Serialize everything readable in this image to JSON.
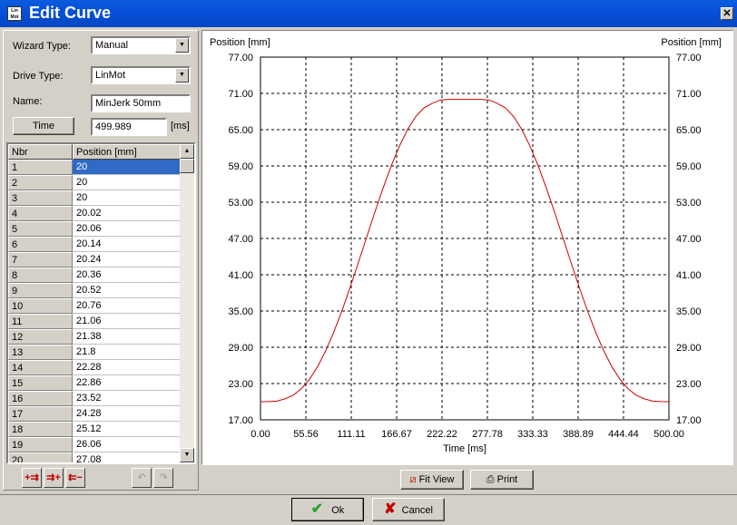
{
  "window": {
    "title": "Edit Curve",
    "app_icon_text": "Lin Mot",
    "close_glyph": "✕"
  },
  "form": {
    "wizard_type_label": "Wizard Type:",
    "wizard_type_value": "Manual",
    "drive_type_label": "Drive Type:",
    "drive_type_value": "LinMot",
    "name_label": "Name:",
    "name_value": "MinJerk 50mm",
    "time_button_label": "Time",
    "time_value": "499.989",
    "time_unit": "[ms]"
  },
  "table": {
    "headers": [
      "Nbr",
      "Position [mm]"
    ],
    "selected_row": 0,
    "rows": [
      {
        "nbr": "1",
        "pos": "20"
      },
      {
        "nbr": "2",
        "pos": "20"
      },
      {
        "nbr": "3",
        "pos": "20"
      },
      {
        "nbr": "4",
        "pos": "20.02"
      },
      {
        "nbr": "5",
        "pos": "20.06"
      },
      {
        "nbr": "6",
        "pos": "20.14"
      },
      {
        "nbr": "7",
        "pos": "20.24"
      },
      {
        "nbr": "8",
        "pos": "20.36"
      },
      {
        "nbr": "9",
        "pos": "20.52"
      },
      {
        "nbr": "10",
        "pos": "20.76"
      },
      {
        "nbr": "11",
        "pos": "21.06"
      },
      {
        "nbr": "12",
        "pos": "21.38"
      },
      {
        "nbr": "13",
        "pos": "21.8"
      },
      {
        "nbr": "14",
        "pos": "22.28"
      },
      {
        "nbr": "15",
        "pos": "22.86"
      },
      {
        "nbr": "16",
        "pos": "23.52"
      },
      {
        "nbr": "17",
        "pos": "24.28"
      },
      {
        "nbr": "18",
        "pos": "25.12"
      },
      {
        "nbr": "19",
        "pos": "26.06"
      },
      {
        "nbr": "20",
        "pos": "27.08"
      }
    ]
  },
  "toolbar": {
    "insert_before_glyph": "+⇉",
    "insert_after_glyph": "⇉+",
    "delete_glyph": "⇇−",
    "undo_glyph": "↶",
    "redo_glyph": "↷"
  },
  "chart_buttons": {
    "fit_view_label": "Fit View",
    "print_label": "Print",
    "fit_view_icon": "⧄",
    "print_icon": "⎙"
  },
  "dialog_buttons": {
    "ok_label": "Ok",
    "cancel_label": "Cancel",
    "ok_icon": "✔",
    "cancel_icon": "✘"
  },
  "chart_data": {
    "type": "line",
    "xlabel": "Time [ms]",
    "ylabel": "Position [mm]",
    "ylabel_right": "Position [mm]",
    "xlim": [
      0,
      500
    ],
    "ylim": [
      17,
      77
    ],
    "x_ticks": [
      "0.00",
      "55.56",
      "111.11",
      "166.67",
      "222.22",
      "277.78",
      "333.33",
      "388.89",
      "444.44",
      "500.00"
    ],
    "y_ticks": [
      "17.00",
      "23.00",
      "29.00",
      "35.00",
      "41.00",
      "47.00",
      "53.00",
      "59.00",
      "65.00",
      "71.00",
      "77.00"
    ],
    "grid": true,
    "line_color": "#cc0000",
    "series": [
      {
        "x": [
          0,
          10,
          20,
          30,
          40,
          50,
          60,
          70,
          80,
          90,
          100,
          110,
          120,
          130,
          140,
          150,
          160,
          170,
          180,
          190,
          200,
          210,
          220,
          230,
          240,
          250,
          260,
          270,
          280,
          290,
          300,
          310,
          320,
          330,
          340,
          350,
          360,
          370,
          380,
          390,
          400,
          410,
          420,
          430,
          440,
          450,
          460,
          470,
          480,
          490,
          500
        ],
        "y": [
          20,
          20.01,
          20.1,
          20.47,
          21.06,
          22.14,
          23.7,
          25.82,
          28.47,
          31.6,
          35.15,
          39.01,
          43.08,
          47.23,
          51.35,
          55.31,
          58.99,
          62.26,
          65.01,
          67.15,
          68.6,
          69.34,
          69.9,
          70,
          70,
          70,
          70,
          70,
          69.9,
          69.34,
          68.6,
          67.15,
          65.01,
          62.26,
          58.99,
          55.31,
          51.35,
          47.23,
          43.08,
          39.01,
          35.15,
          31.6,
          28.47,
          25.82,
          23.7,
          22.14,
          21.06,
          20.47,
          20.1,
          20.01,
          20
        ]
      }
    ]
  }
}
